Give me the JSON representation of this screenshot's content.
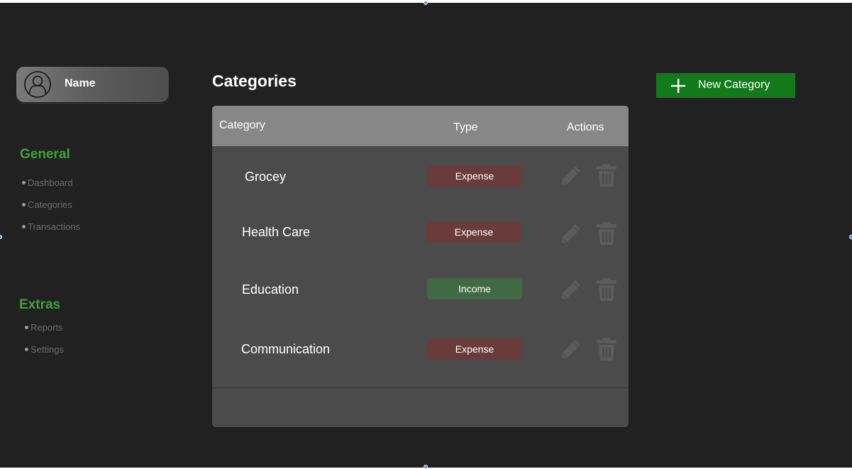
{
  "user": {
    "name": "Name",
    "avatar_icon": "user-circle-icon"
  },
  "sidebar": {
    "general": {
      "title": "General",
      "items": [
        "Dashboard",
        "Categories",
        "Transactions"
      ]
    },
    "extras": {
      "title": "Extras",
      "items": [
        "Reports",
        "Settings"
      ]
    }
  },
  "main": {
    "title": "Categories",
    "new_button": {
      "label": "New Category",
      "icon": "plus-icon"
    }
  },
  "table": {
    "headers": {
      "category": "Category",
      "type": "Type",
      "actions": "Actions"
    },
    "rows": [
      {
        "name": "Grocey",
        "type": "Expense"
      },
      {
        "name": "Health Care",
        "type": "Expense"
      },
      {
        "name": "Education",
        "type": "Income"
      },
      {
        "name": "Communication",
        "type": "Expense"
      }
    ],
    "action_icons": [
      "pencil-icon",
      "trash-icon"
    ]
  },
  "colors": {
    "background": "#212121",
    "accent_green": "#3fa33a",
    "button_green": "#137a1b",
    "expense": "#6a3b3b",
    "income": "#3f6a43",
    "panel": "#4b4b4b",
    "header_row": "#878787"
  }
}
